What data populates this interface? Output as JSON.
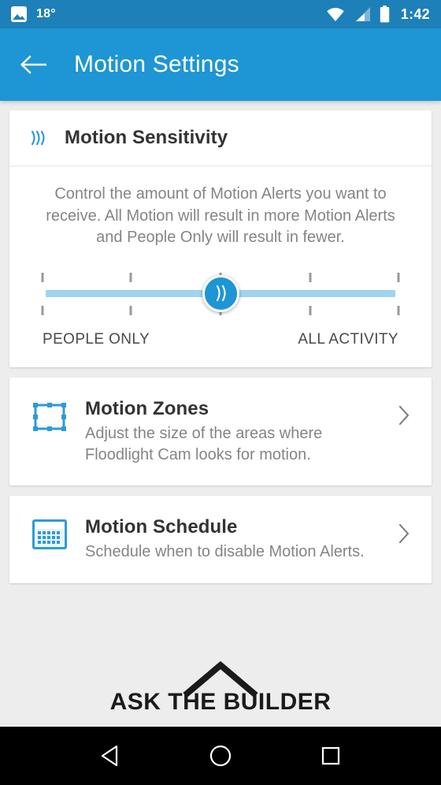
{
  "status_bar": {
    "photo_icon": "photo-icon",
    "temperature": "18°",
    "wifi_icon": "wifi-icon",
    "signal_icon": "signal-icon",
    "battery_icon": "battery-icon",
    "time": "1:42",
    "background_color": "#1e80b8"
  },
  "app_bar": {
    "back_icon": "back-arrow-icon",
    "title": "Motion Settings",
    "background_color": "#1e95d4"
  },
  "sensitivity_card": {
    "icon": "motion-waves-icon",
    "title": "Motion Sensitivity",
    "description": "Control the amount of Motion Alerts you want to receive. All Motion will result in more Motion Alerts and People Only will result in fewer.",
    "slider": {
      "thumb_icon": "double-chevron-icon",
      "tick_count": 5,
      "value": 3,
      "min": 1,
      "max": 5,
      "value_percent": 50,
      "track_color": "#9fd4f0",
      "thumb_color": "#1e95d4",
      "min_label": "PEOPLE ONLY",
      "max_label": "ALL ACTIVITY"
    }
  },
  "rows": [
    {
      "icon": "motion-zones-rectangle-icon",
      "title": "Motion Zones",
      "subtitle": "Adjust the size of the areas where Floodlight Cam looks for motion.",
      "chevron": "chevron-right-icon"
    },
    {
      "icon": "calendar-icon",
      "title": "Motion Schedule",
      "subtitle": "Schedule when to disable Motion Alerts.",
      "chevron": "chevron-right-icon"
    }
  ],
  "watermark": {
    "logo_icon": "house-roof-icon",
    "text": "ASK THE BUILDER"
  },
  "nav_bar": {
    "back": "nav-back-triangle-icon",
    "home": "nav-home-circle-icon",
    "recents": "nav-recents-square-icon",
    "background_color": "#000000"
  }
}
